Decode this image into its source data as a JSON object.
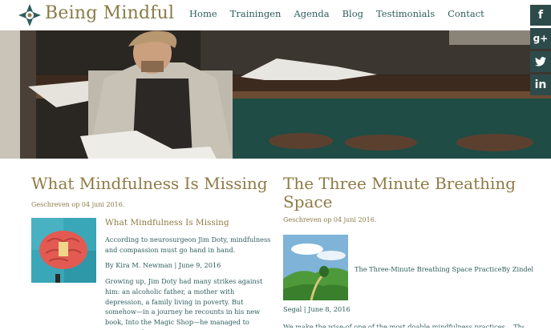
{
  "header": {
    "brand": "Being Mindful",
    "nav": [
      "Home",
      "Trainingen",
      "Agenda",
      "Blog",
      "Testimonials",
      "Contact"
    ]
  },
  "social": {
    "facebook": "f",
    "googleplus": "g+",
    "twitter": "twitter-icon",
    "linkedin": "in"
  },
  "colors": {
    "brand_gold": "#8f7a45",
    "teal": "#2f5d5d",
    "social_bg": "#2e4b4b"
  },
  "posts": {
    "left": {
      "title": "What Mindfulness Is Missing",
      "meta": "Geschreven op 04 juni 2016.",
      "excerpt_title": "What Mindfulness Is Missing",
      "excerpt_p1": "According to neurosurgeon Jim Doty, mindfulness and compassion must go hand in hand.",
      "byline": "By Kira M. Newman | June 9, 2016",
      "excerpt_p2": "Growing up, Jim Doty had many strikes against him: an alcoholic father, a mother with depression, a family living in poverty. But somehow—in a journey he recounts in his new book, Into the Magic Shop—he managed to overcome them."
    },
    "right": {
      "title": "The Three Minute Breathing Space",
      "meta": "Geschreven op 04 juni 2016.",
      "caption": "The Three-Minute Breathing Space PracticeBy Zindel",
      "byline": "Segal | June 8, 2016",
      "cut": "We make the wise-of one of the most doable mindfulness practices... The"
    }
  }
}
